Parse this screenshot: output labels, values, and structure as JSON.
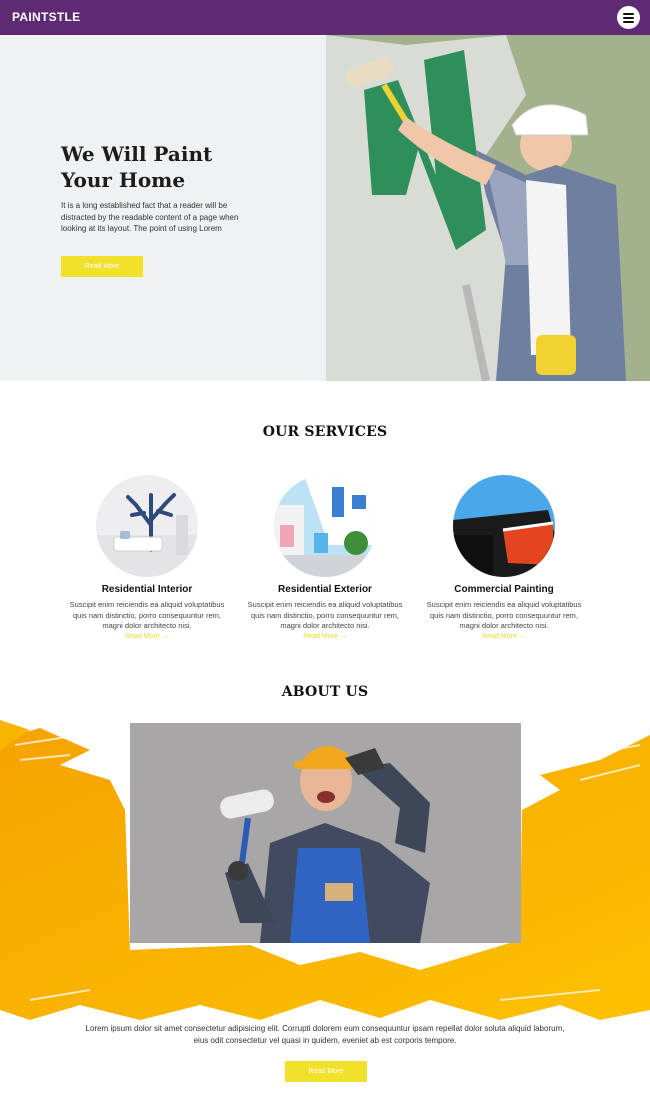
{
  "header": {
    "brand": "PAINTSTLE",
    "menu_icon": "hamburger-menu-icon"
  },
  "hero": {
    "title_line1": "We Will Paint",
    "title_line2": "Your Home",
    "text": "It is a long established fact that a reader will be distracted by the readable content of a page when looking at its layout. The point of using Lorem",
    "button": "Read More"
  },
  "services": {
    "title": "OUR SERVICES",
    "items": [
      {
        "name": "Residential Interior",
        "desc": "Suscipit enim reiciendis ea aliquid voluptatibus quis nam distinctio, porro consequuntur rem, magni dolor architecto nisi.",
        "link": "Read More →"
      },
      {
        "name": "Residential Exterior",
        "desc": "Suscipit enim reiciendis ea aliquid voluptatibus quis nam distinctio, porro consequuntur rem, magni dolor architecto nisi.",
        "link": "Read More →"
      },
      {
        "name": "Commercial Painting",
        "desc": "Suscipit enim reiciendis ea aliquid voluptatibus quis nam distinctio, porro consequuntur rem, magni dolor architecto nisi.",
        "link": "Read More →"
      }
    ]
  },
  "about": {
    "title": "ABOUT US",
    "text": "Lorem ipsum dolor sit amet consectetur adipisicing elit. Corrupti dolorem eum consequuntur ipsam repellat dolor soluta aliquid laborum, eius odit consectetur vel quasi in quidem, eveniet ab est corporis tempore.",
    "button": "Read More"
  },
  "colors": {
    "header": "#5e2a73",
    "accent": "#f2e12b",
    "paint_yellow": "#f7b500",
    "wall_green": "#2f8f5a"
  }
}
